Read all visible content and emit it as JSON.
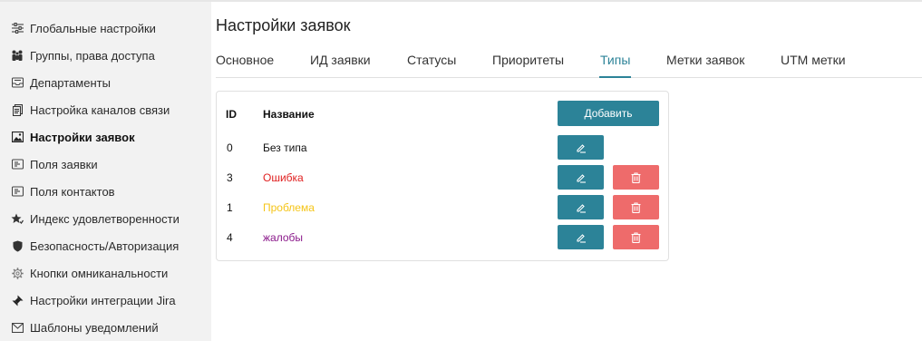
{
  "sidebar": {
    "items": [
      {
        "label": "Глобальные настройки",
        "icon": "sliders-icon"
      },
      {
        "label": "Группы, права доступа",
        "icon": "users-icon"
      },
      {
        "label": "Департаменты",
        "icon": "inbox-icon"
      },
      {
        "label": "Настройка каналов связи",
        "icon": "document-icon"
      },
      {
        "label": "Настройки заявок",
        "icon": "image-icon",
        "active": true
      },
      {
        "label": "Поля заявки",
        "icon": "form-icon"
      },
      {
        "label": "Поля контактов",
        "icon": "form-icon"
      },
      {
        "label": "Индекс удовлетворенности",
        "icon": "star-icon"
      },
      {
        "label": "Безопасность/Авторизация",
        "icon": "shield-icon"
      },
      {
        "label": "Кнопки омниканальности",
        "icon": "gear-icon"
      },
      {
        "label": "Настройки интеграции Jira",
        "icon": "jira-icon"
      },
      {
        "label": "Шаблоны уведомлений",
        "icon": "envelope-icon"
      }
    ]
  },
  "main": {
    "title": "Настройки заявок",
    "tabs": [
      {
        "label": "Основное"
      },
      {
        "label": "ИД заявки"
      },
      {
        "label": "Статусы"
      },
      {
        "label": "Приоритеты"
      },
      {
        "label": "Типы",
        "active": true
      },
      {
        "label": "Метки заявок"
      },
      {
        "label": "UTM метки"
      }
    ],
    "table": {
      "col_id": "ID",
      "col_name": "Название",
      "add_label": "Добавить",
      "rows": [
        {
          "id": "0",
          "name": "Без типа",
          "color": "#111111",
          "deletable": false
        },
        {
          "id": "3",
          "name": "Ошибка",
          "color": "#e02020",
          "deletable": true
        },
        {
          "id": "1",
          "name": "Проблема",
          "color": "#f5c518",
          "deletable": true
        },
        {
          "id": "4",
          "name": "жалобы",
          "color": "#8b1a8b",
          "deletable": true
        }
      ]
    }
  },
  "colors": {
    "accent": "#2c8398",
    "danger": "#ee6b6b"
  }
}
